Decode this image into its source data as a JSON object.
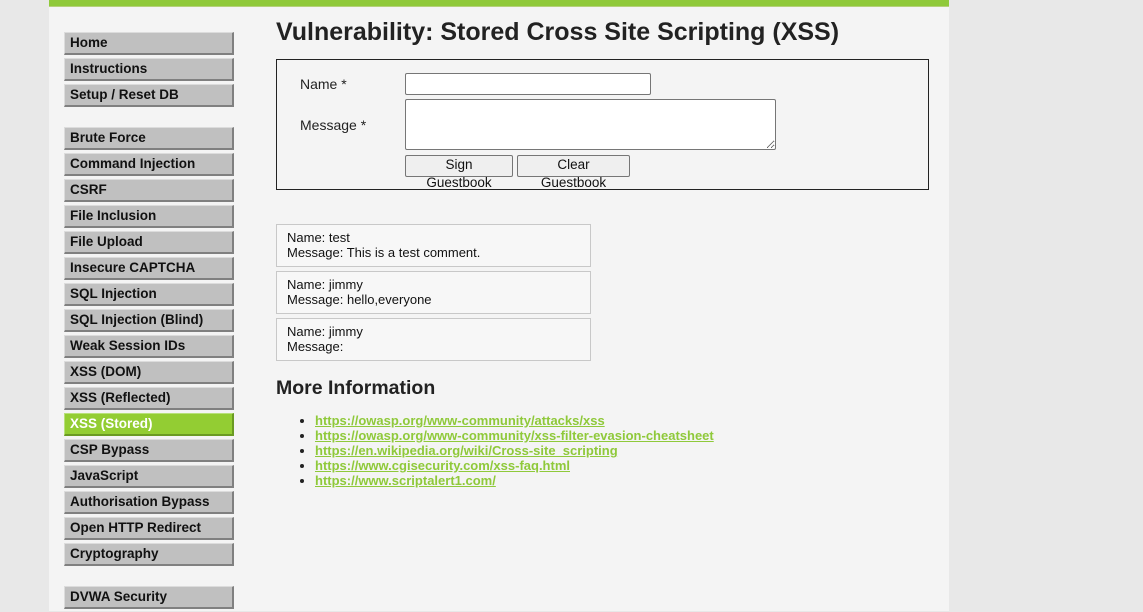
{
  "page": {
    "title": "Vulnerability: Stored Cross Site Scripting (XSS)",
    "accent_color": "#8fc93a"
  },
  "sidebar": {
    "groups": [
      {
        "items": [
          {
            "label": "Home",
            "active": false
          },
          {
            "label": "Instructions",
            "active": false
          },
          {
            "label": "Setup / Reset DB",
            "active": false
          }
        ]
      },
      {
        "items": [
          {
            "label": "Brute Force",
            "active": false
          },
          {
            "label": "Command Injection",
            "active": false
          },
          {
            "label": "CSRF",
            "active": false
          },
          {
            "label": "File Inclusion",
            "active": false
          },
          {
            "label": "File Upload",
            "active": false
          },
          {
            "label": "Insecure CAPTCHA",
            "active": false
          },
          {
            "label": "SQL Injection",
            "active": false
          },
          {
            "label": "SQL Injection (Blind)",
            "active": false
          },
          {
            "label": "Weak Session IDs",
            "active": false
          },
          {
            "label": "XSS (DOM)",
            "active": false
          },
          {
            "label": "XSS (Reflected)",
            "active": false
          },
          {
            "label": "XSS (Stored)",
            "active": true
          },
          {
            "label": "CSP Bypass",
            "active": false
          },
          {
            "label": "JavaScript",
            "active": false
          },
          {
            "label": "Authorisation Bypass",
            "active": false
          },
          {
            "label": "Open HTTP Redirect",
            "active": false
          },
          {
            "label": "Cryptography",
            "active": false
          }
        ]
      },
      {
        "items": [
          {
            "label": "DVWA Security",
            "active": false
          }
        ]
      }
    ]
  },
  "form": {
    "name_label": "Name *",
    "name_value": "",
    "message_label": "Message *",
    "message_value": "",
    "sign_button": "Sign Guestbook",
    "clear_button": "Clear Guestbook"
  },
  "entries": [
    {
      "name": "Name: test",
      "message": "Message: This is a test comment."
    },
    {
      "name": "Name: jimmy",
      "message": "Message: hello,everyone"
    },
    {
      "name": "Name: jimmy",
      "message": "Message: "
    }
  ],
  "more_info": {
    "heading": "More Information",
    "links": [
      "https://owasp.org/www-community/attacks/xss",
      "https://owasp.org/www-community/xss-filter-evasion-cheatsheet",
      "https://en.wikipedia.org/wiki/Cross-site_scripting",
      "https://www.cgisecurity.com/xss-faq.html",
      "https://www.scriptalert1.com/"
    ]
  }
}
